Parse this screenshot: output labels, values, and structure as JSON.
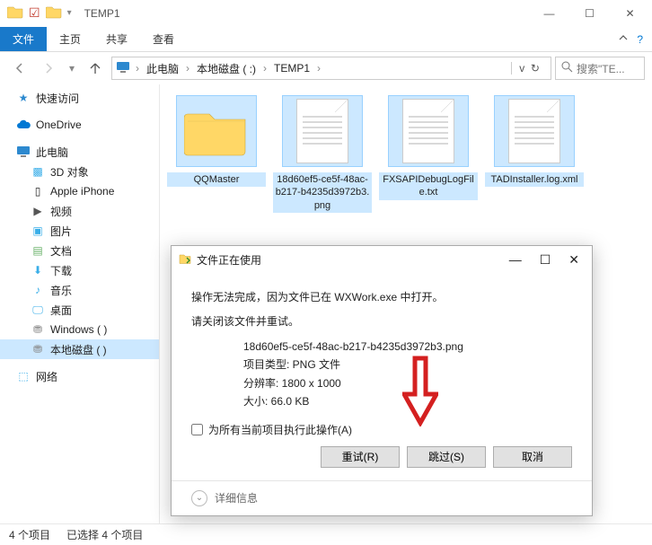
{
  "window": {
    "title": "TEMP1",
    "wincontrols": {
      "min": "—",
      "max": "☐",
      "close": "✕"
    }
  },
  "ribbon": {
    "file": "文件",
    "tabs": [
      "主页",
      "共享",
      "查看"
    ],
    "expand_hint": "^"
  },
  "nav": {
    "crumbs": [
      "此电脑",
      "本地磁盘 (  :)",
      "TEMP1"
    ],
    "search_placeholder": "搜索\"TE..."
  },
  "sidebar": {
    "quick": "快速访问",
    "onedrive": "OneDrive",
    "thispc": "此电脑",
    "children": [
      "3D 对象",
      "Apple iPhone",
      "视频",
      "图片",
      "文档",
      "下载",
      "音乐",
      "桌面",
      "Windows (  )",
      "本地磁盘 (  )"
    ],
    "network": "网络"
  },
  "files": [
    {
      "name": "QQMaster",
      "type": "folder"
    },
    {
      "name": "18d60ef5-ce5f-48ac-b217-b4235d3972b3.png",
      "type": "doc"
    },
    {
      "name": "FXSAPIDebugLogFile.txt",
      "type": "doc"
    },
    {
      "name": "TADInstaller.log.xml",
      "type": "doc"
    }
  ],
  "statusbar": {
    "count": "4 个项目",
    "selected": "已选择 4 个项目"
  },
  "dialog": {
    "title": "文件正在使用",
    "line1": "操作无法完成，因为文件已在 WXWork.exe 中打开。",
    "line2": "请关闭该文件并重试。",
    "details": {
      "filename": "18d60ef5-ce5f-48ac-b217-b4235d3972b3.png",
      "type_label": "项目类型: PNG 文件",
      "resolution_label": "分辨率: 1800 x 1000",
      "size_label": "大小: 66.0 KB"
    },
    "checkbox_label": "为所有当前项目执行此操作(A)",
    "buttons": {
      "retry": "重试(R)",
      "skip": "跳过(S)",
      "cancel": "取消"
    },
    "expand": "详细信息"
  }
}
